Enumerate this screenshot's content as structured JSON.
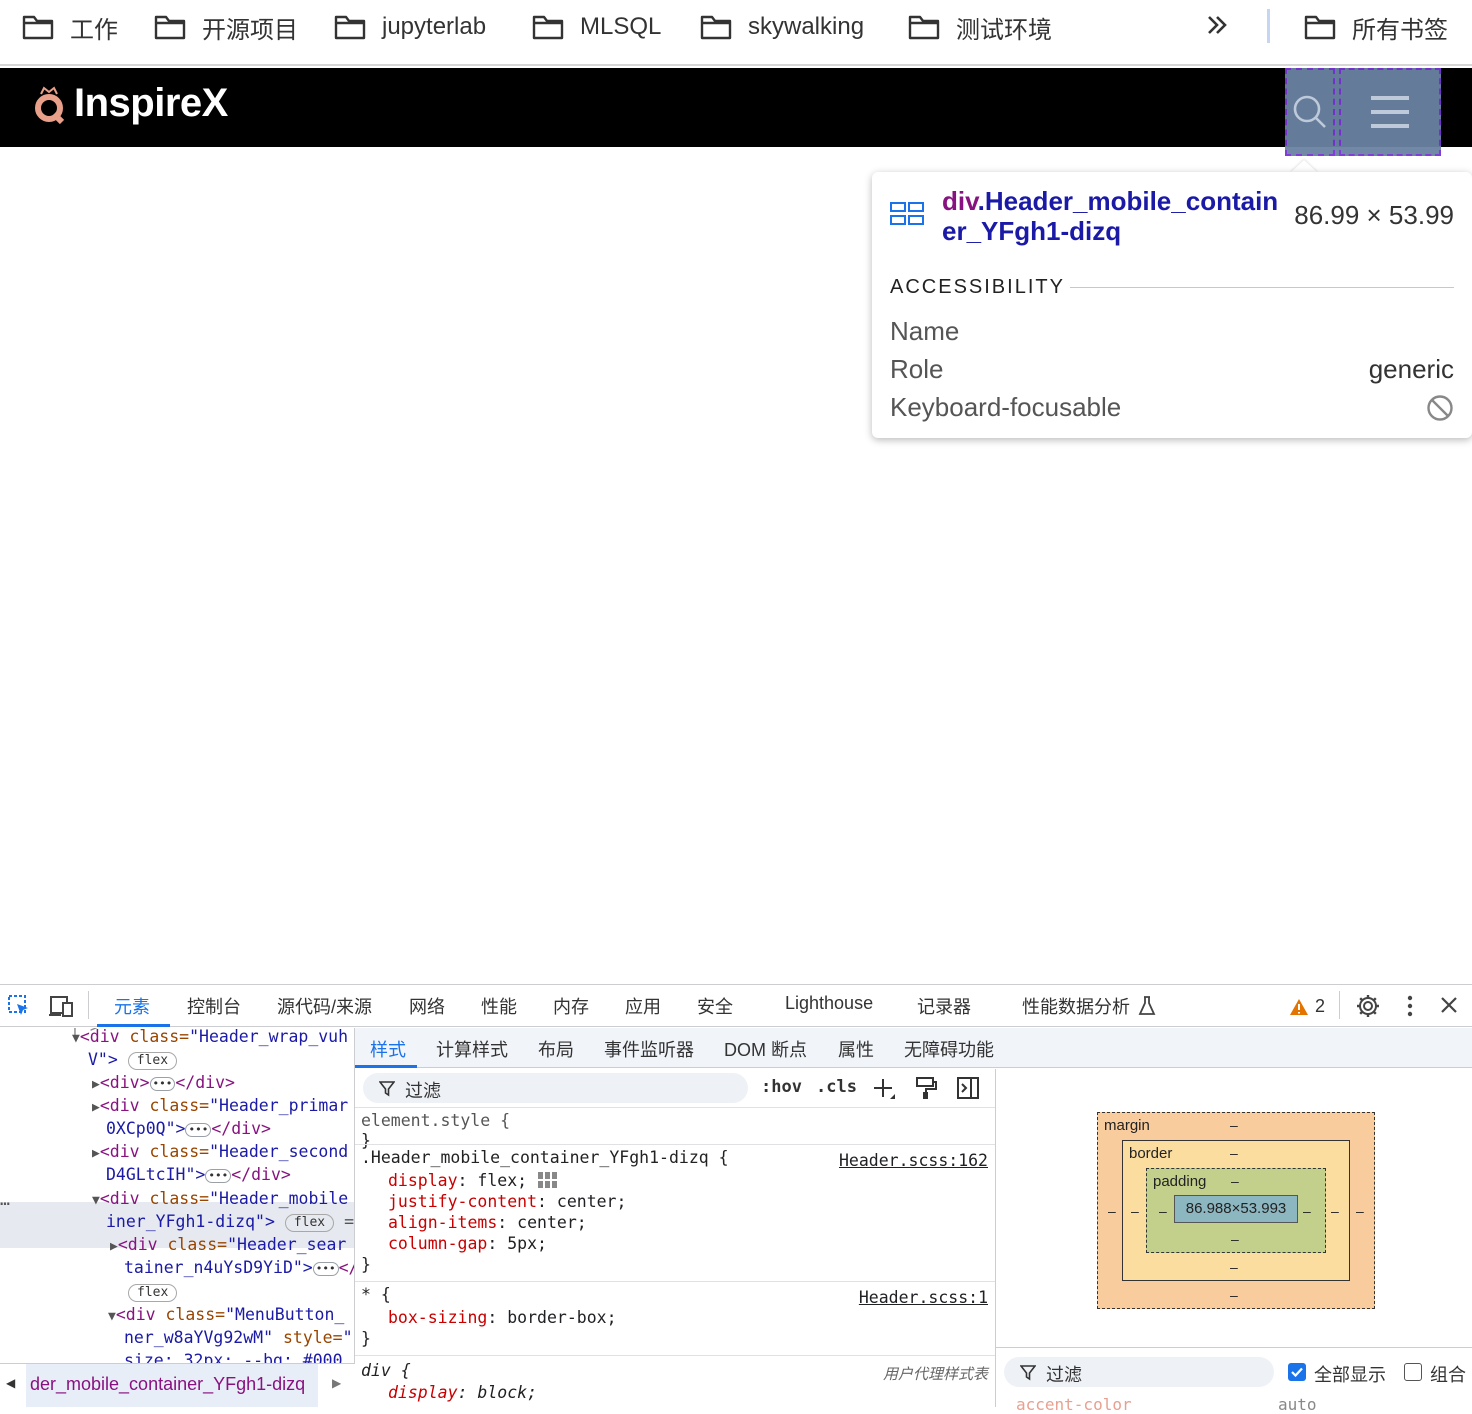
{
  "bookmarks": {
    "items": [
      "工作",
      "开源项目",
      "jupyterlab",
      "MLSQL",
      "skywalking",
      "测试环境"
    ],
    "more": "»",
    "all_bookmarks": "所有书签"
  },
  "site": {
    "logo_text": "InspireX"
  },
  "tooltip": {
    "tag": "div",
    "class_name": ".Header_mobile_container_YFgh1-dizq",
    "size": "86.99 × 53.99",
    "section": "ACCESSIBILITY",
    "rows": [
      {
        "label": "Name",
        "value": ""
      },
      {
        "label": "Role",
        "value": "generic"
      },
      {
        "label": "Keyboard-focusable",
        "value": ""
      }
    ]
  },
  "devtools": {
    "tabs": [
      "元素",
      "控制台",
      "源代码/来源",
      "网络",
      "性能",
      "内存",
      "应用",
      "安全",
      "Lighthouse",
      "记录器",
      "性能数据分析"
    ],
    "warning_count": "2",
    "elements": {
      "lines": [
        {
          "tag_open": "<div ",
          "attr": "class=",
          "val": "\"Header_wrap_vuh",
          "tail": ""
        },
        {
          "text": "V\">"
        },
        {
          "tag_open": "<div>",
          "tail": "</div>"
        },
        {
          "tag_open": "<div ",
          "attr": "class=",
          "val": "\"Header_primar",
          "tail": ""
        },
        {
          "text": "0XCp0Q\">",
          "tail": "</div>"
        },
        {
          "tag_open": "<div ",
          "attr": "class=",
          "val": "\"Header_second",
          "tail": ""
        },
        {
          "text": "D4GLtcIH\">",
          "tail": "</div>"
        },
        {
          "tag_open": "<div ",
          "attr": "class=",
          "val": "\"Header_mobile",
          "tail": ""
        },
        {
          "text": "iner_YFgh1-dizq\">",
          "tail": "=="
        },
        {
          "tag_open": "<div ",
          "attr": "class=",
          "val": "\"Header_sear",
          "tail": ""
        },
        {
          "text": "tainer_n4uYsD9YiD\">",
          "tail": "</"
        },
        {
          "tag_open": "<div ",
          "attr": "class=",
          "val": "\"MenuButton_",
          "tail": ""
        },
        {
          "text": "ner_w8aYVg92wM\"",
          "attr2": " style=",
          "val2": "\"-"
        },
        {
          "text": "  size: 32px; --bg: #000"
        }
      ],
      "pill_flex": "flex",
      "breadcrumb": "der_mobile_container_YFgh1-dizq"
    },
    "styles_tabs": [
      "样式",
      "计算样式",
      "布局",
      "事件监听器",
      "DOM 断点",
      "属性",
      "无障碍功能"
    ],
    "filter_placeholder": "过滤",
    "hov": ":hov",
    "cls": ".cls",
    "rules": [
      {
        "selector": "element.style {",
        "close": "}",
        "source": ""
      },
      {
        "selector": ".Header_mobile_container_YFgh1-dizq {",
        "source": "Header.scss:162",
        "decls": [
          [
            "display",
            "flex"
          ],
          [
            "justify-content",
            "center"
          ],
          [
            "align-items",
            "center"
          ],
          [
            "column-gap",
            "5px"
          ]
        ],
        "close": "}"
      },
      {
        "selector": "* {",
        "source": "Header.scss:1",
        "decls": [
          [
            "box-sizing",
            "border-box"
          ]
        ],
        "close": "}"
      },
      {
        "selector": "div {",
        "source": "用户代理样式表",
        "decls": [
          [
            "display",
            "block"
          ]
        ]
      }
    ],
    "box_model": {
      "margin": "margin",
      "border": "border",
      "padding": "padding",
      "content": "86.988×53.993",
      "dash": "–"
    },
    "computed": {
      "filter_placeholder": "过滤",
      "show_all": "全部显示",
      "group": "组合",
      "row_name": "accent-color",
      "row_value": "auto"
    }
  },
  "colors": {
    "accent": "#1a73e8",
    "tag": "#881280",
    "attr_value": "#1a1aa6",
    "prop_name": "#c80000",
    "overlay": "#6a82a3"
  }
}
